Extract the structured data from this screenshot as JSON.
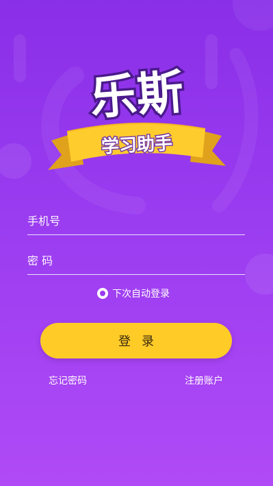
{
  "logo": {
    "title": "乐斯",
    "subtitle": "学习助手"
  },
  "form": {
    "phone_placeholder": "手机号",
    "password_placeholder": "密 码",
    "remember_label": "下次自动登录",
    "remember_checked": true,
    "login_label": "登录"
  },
  "links": {
    "forgot": "忘记密码",
    "register": "注册账户"
  },
  "colors": {
    "bg_top": "#8a2fe8",
    "bg_bottom": "#b04af6",
    "accent": "#ffcb27",
    "logo_stroke": "#4b1a8c"
  }
}
